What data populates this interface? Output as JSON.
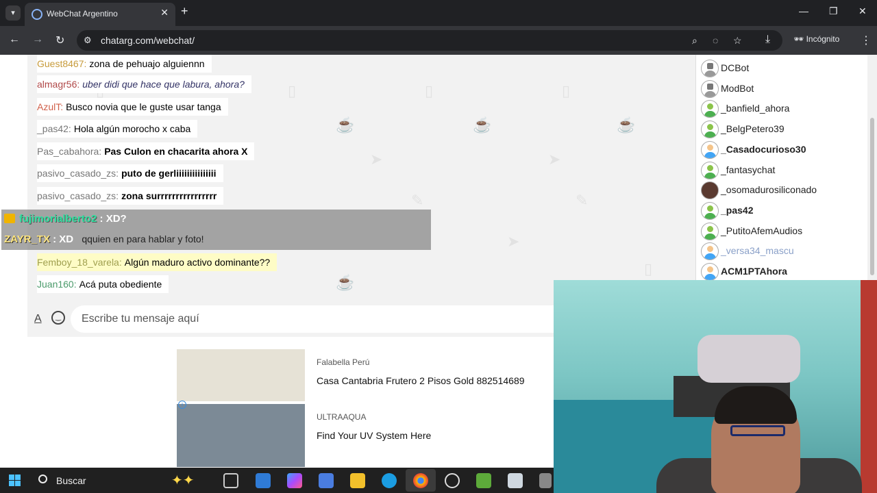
{
  "browser": {
    "tab_title": "WebChat Argentino",
    "url": "chatarg.com/webchat/",
    "incognito_label": "Incógnito"
  },
  "messages": [
    {
      "nick": "Guest8467:",
      "text": "zona de pehuajo alguiennn",
      "nick_color": "#c79b3b",
      "style": "normal",
      "highlight": false
    },
    {
      "nick": "almagr56:",
      "text": "uber didi que hace que labura, ahora?",
      "nick_color": "#b04848",
      "style": "italic",
      "highlight": false
    },
    {
      "nick": "AzulT:",
      "text": "Busco novia que le guste usar tanga",
      "nick_color": "#d0604a",
      "style": "normal",
      "highlight": false
    },
    {
      "nick": "_pas42:",
      "text": "Hola algún morocho x caba",
      "nick_color": "#777777",
      "style": "normal",
      "highlight": false
    },
    {
      "nick": "Pas_cabahora:",
      "text": "Pas Culon en chacarita ahora X",
      "nick_color": "#777777",
      "style": "bold",
      "highlight": false
    },
    {
      "nick": "pasivo_casado_zs:",
      "text": "puto de gerliiiiiiiiiiiiiii",
      "nick_color": "#777777",
      "style": "bold",
      "highlight": false
    },
    {
      "nick": "pasivo_casado_zs:",
      "text": "zona surrrrrrrrrrrrrrrr",
      "nick_color": "#777777",
      "style": "bold",
      "highlight": false
    },
    {
      "nick": "Femboy_18_varela:",
      "text": "Algún maduro activo dominante??",
      "nick_color": "#a0a050",
      "style": "normal",
      "highlight": true
    },
    {
      "nick": "Juan160:",
      "text": "Acá puta obediente",
      "nick_color": "#4a9a6a",
      "style": "normal",
      "highlight": false
    }
  ],
  "overlay": {
    "line1_nick": "fujimorialberto2",
    "line1_text": ": XD?",
    "line2_nick": "ZAYR_TX",
    "line2_text": ": XD",
    "line2_behind": "qquien en para hablar y foto!"
  },
  "compose": {
    "placeholder": "Escribe tu mensaje aquí"
  },
  "users": [
    {
      "name": "DCBot",
      "avatar": "bot",
      "style": "normal"
    },
    {
      "name": "ModBot",
      "avatar": "bot",
      "style": "normal"
    },
    {
      "name": "_banfield_ahora",
      "avatar": "green",
      "style": "normal"
    },
    {
      "name": "_BelgPetero39",
      "avatar": "green",
      "style": "normal"
    },
    {
      "name": "_Casadocurioso30",
      "avatar": "blue",
      "style": "bold"
    },
    {
      "name": "_fantasychat",
      "avatar": "green",
      "style": "normal"
    },
    {
      "name": "_osomadurosiliconado",
      "avatar": "photo",
      "style": "normal"
    },
    {
      "name": "_pas42",
      "avatar": "green",
      "style": "bold"
    },
    {
      "name": "_PutitoAfemAudios",
      "avatar": "green",
      "style": "normal"
    },
    {
      "name": "_versa34_mascu",
      "avatar": "blue",
      "style": "grey"
    },
    {
      "name": "ACM1PTAhora",
      "avatar": "blue",
      "style": "bold"
    }
  ],
  "ads": [
    {
      "source": "Falabella Perú",
      "headline": "Casa Cantabria Frutero 2 Pisos Gold 882514689"
    },
    {
      "source": "ULTRAAQUA",
      "headline": "Find Your UV System Here"
    }
  ],
  "taskbar": {
    "search_label": "Buscar"
  }
}
